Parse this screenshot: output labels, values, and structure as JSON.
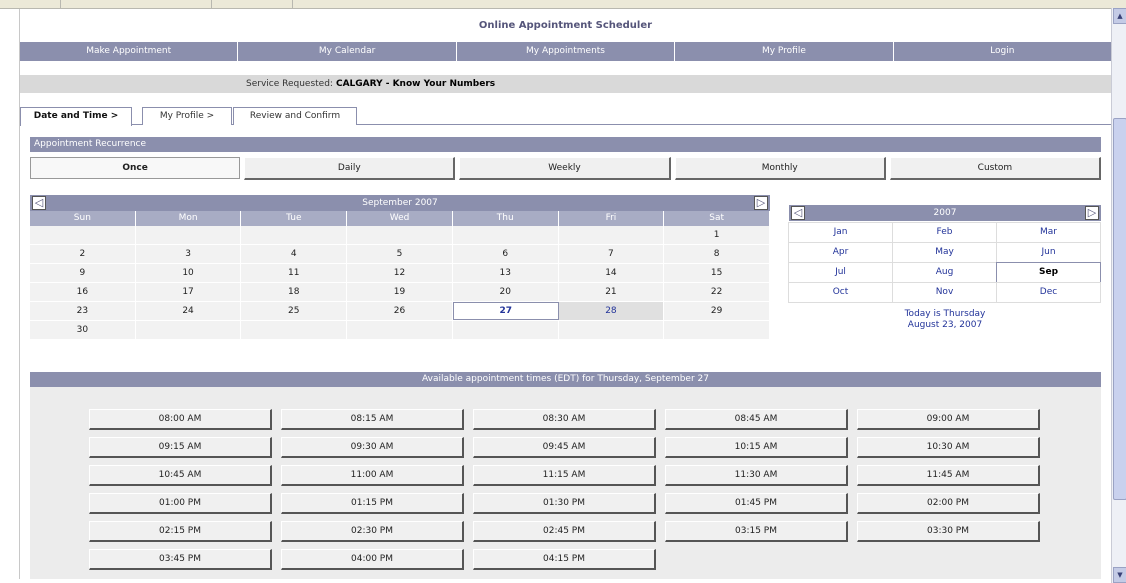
{
  "app": {
    "title": "Online Appointment Scheduler"
  },
  "nav": [
    "Make Appointment",
    "My Calendar",
    "My Appointments",
    "My Profile",
    "Login"
  ],
  "service": {
    "label": "Service Requested:",
    "value": "CALGARY - Know Your Numbers"
  },
  "tabs": [
    "Date and Time >",
    "My Profile >",
    "Review and Confirm"
  ],
  "recurrence": {
    "title": "Appointment Recurrence",
    "options": [
      "Once",
      "Daily",
      "Weekly",
      "Monthly",
      "Custom"
    ],
    "selected": "Once"
  },
  "calendar": {
    "title": "September 2007",
    "days": [
      "Sun",
      "Mon",
      "Tue",
      "Wed",
      "Thu",
      "Fri",
      "Sat"
    ],
    "cells": [
      "",
      "",
      "",
      "",
      "",
      "",
      "1",
      "2",
      "3",
      "4",
      "5",
      "6",
      "7",
      "8",
      "9",
      "10",
      "11",
      "12",
      "13",
      "14",
      "15",
      "16",
      "17",
      "18",
      "19",
      "20",
      "21",
      "22",
      "23",
      "24",
      "25",
      "26",
      "27",
      "28",
      "29",
      "30",
      "",
      "",
      "",
      "",
      "",
      ""
    ],
    "selected": "27",
    "available": [
      "28"
    ]
  },
  "months": {
    "year": "2007",
    "items": [
      "Jan",
      "Feb",
      "Mar",
      "Apr",
      "May",
      "Jun",
      "Jul",
      "Aug",
      "Sep",
      "Oct",
      "Nov",
      "Dec"
    ],
    "selected": "Sep",
    "today_line1": "Today is Thursday",
    "today_line2": "August 23, 2007"
  },
  "times": {
    "title": "Available appointment times (EDT) for Thursday, September 27",
    "slots": [
      "08:00 AM",
      "08:15 AM",
      "08:30 AM",
      "08:45 AM",
      "09:00 AM",
      "09:15 AM",
      "09:30 AM",
      "09:45 AM",
      "10:15 AM",
      "10:30 AM",
      "10:45 AM",
      "11:00 AM",
      "11:15 AM",
      "11:30 AM",
      "11:45 AM",
      "01:00 PM",
      "01:15 PM",
      "01:30 PM",
      "01:45 PM",
      "02:00 PM",
      "02:15 PM",
      "02:30 PM",
      "02:45 PM",
      "03:15 PM",
      "03:30 PM",
      "03:45 PM",
      "04:00 PM",
      "04:15 PM"
    ]
  }
}
